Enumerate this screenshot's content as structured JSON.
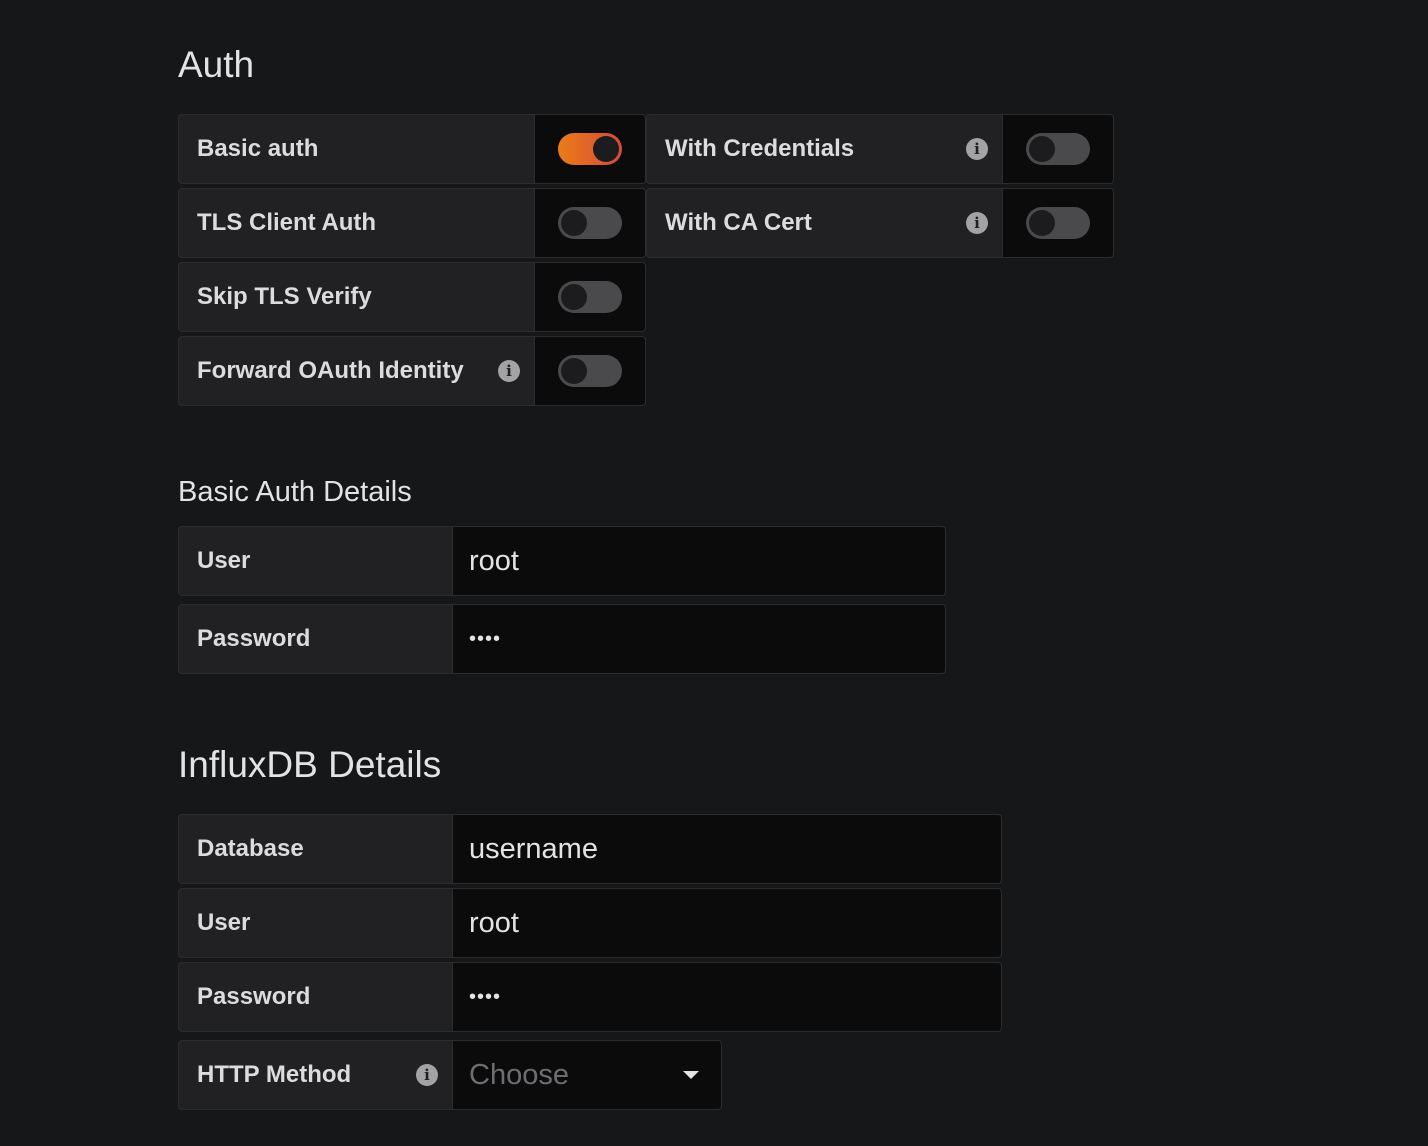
{
  "auth": {
    "heading": "Auth",
    "toggles": {
      "basic_auth": {
        "label": "Basic auth",
        "enabled": true
      },
      "with_credentials": {
        "label": "With Credentials",
        "enabled": false
      },
      "tls_client_auth": {
        "label": "TLS Client Auth",
        "enabled": false
      },
      "with_ca_cert": {
        "label": "With CA Cert",
        "enabled": false
      },
      "skip_tls_verify": {
        "label": "Skip TLS Verify",
        "enabled": false
      },
      "forward_oauth": {
        "label": "Forward OAuth Identity",
        "enabled": false
      }
    },
    "info_icon": "info-circle-icon"
  },
  "basic_auth_details": {
    "heading": "Basic Auth Details",
    "user_label": "User",
    "user_value": "root",
    "password_label": "Password",
    "password_value": "••••"
  },
  "influxdb_details": {
    "heading": "InfluxDB Details",
    "database_label": "Database",
    "database_value": "username",
    "user_label": "User",
    "user_value": "root",
    "password_label": "Password",
    "password_value": "••••",
    "http_method_label": "HTTP Method",
    "http_method_placeholder": "Choose",
    "http_method_icon": "caret-down-icon"
  },
  "colors": {
    "background": "#161719",
    "label_bg": "#212124",
    "input_bg": "#0b0b0c",
    "toggle_on_start": "#eb7b18",
    "toggle_on_end": "#d44a3a",
    "toggle_off": "#4a4a4c"
  }
}
